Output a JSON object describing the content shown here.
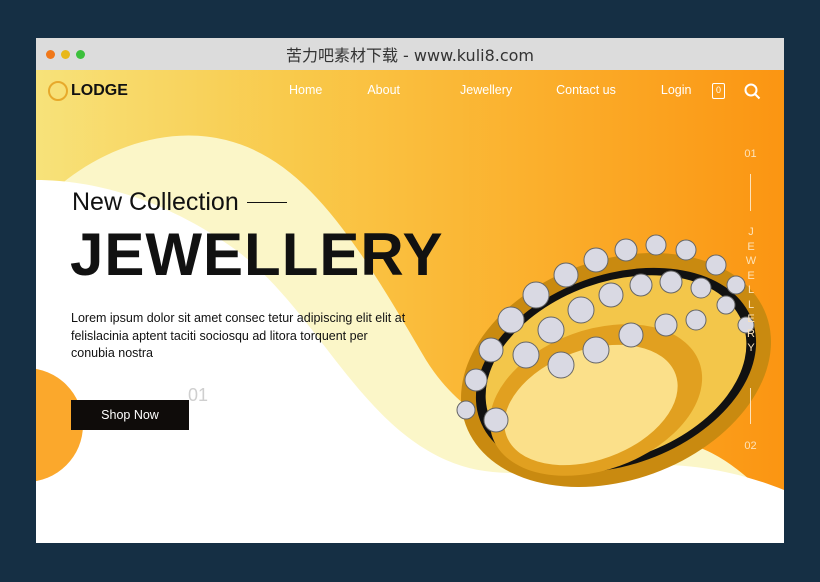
{
  "window": {
    "title": "苦力吧素材下载 - www.kuli8.com",
    "dots": [
      "#f0781a",
      "#e8b81a",
      "#3cc03c"
    ]
  },
  "nav": {
    "logo": "LODGE",
    "links": [
      "Home",
      "About",
      "Jewellery",
      "Contact us",
      "Login"
    ],
    "cart_count": "0",
    "icons": [
      "shopping-bag-icon",
      "search-icon"
    ]
  },
  "hero": {
    "subtitle": "New Collection",
    "title": "JEWELLERY",
    "description": "Lorem ipsum dolor sit amet consec tetur adipiscing elit elit at felislacinia aptent taciti sociosqu ad litora torquent per conubia nostra",
    "button": "Shop Now",
    "slide_number": "01"
  },
  "slider": {
    "top": "01",
    "label": "JEWELLERY",
    "bottom": "02"
  },
  "colors": {
    "accent": "#fb9512",
    "yellow": "#f7e27a",
    "dark": "#0f0c0a"
  }
}
